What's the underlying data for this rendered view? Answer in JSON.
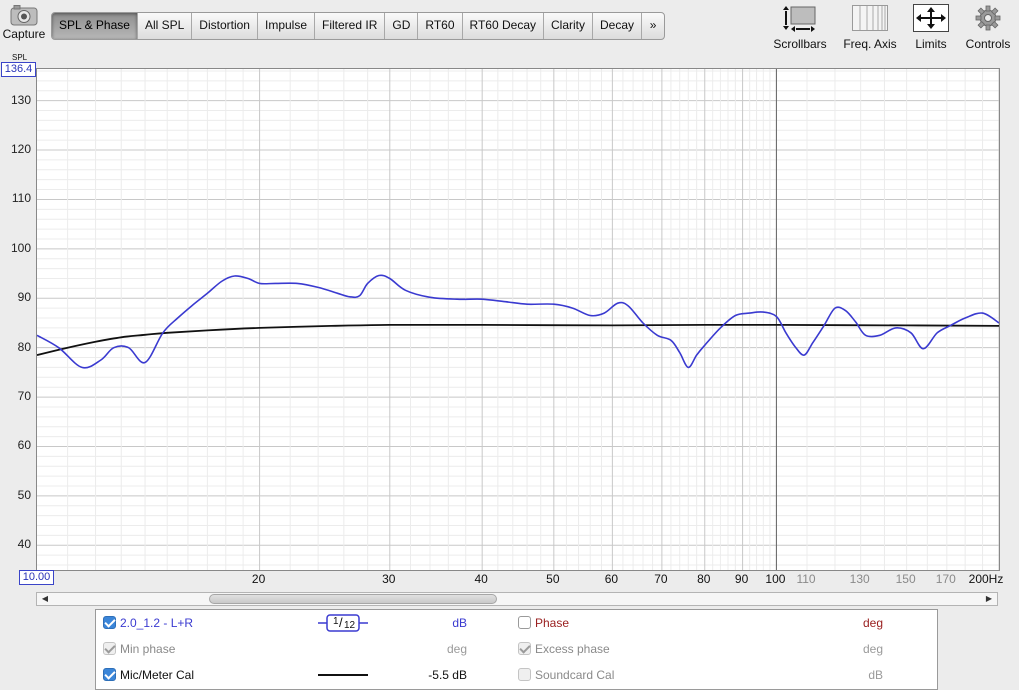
{
  "capture": {
    "label": "Capture",
    "icon": "camera-icon"
  },
  "tabs": [
    {
      "label": "SPL & Phase",
      "active": true
    },
    {
      "label": "All SPL"
    },
    {
      "label": "Distortion"
    },
    {
      "label": "Impulse"
    },
    {
      "label": "Filtered IR"
    },
    {
      "label": "GD"
    },
    {
      "label": "RT60"
    },
    {
      "label": "RT60 Decay"
    },
    {
      "label": "Clarity"
    },
    {
      "label": "Decay"
    },
    {
      "label": "»"
    }
  ],
  "toolbar": {
    "scrollbars": "Scrollbars",
    "freq_axis": "Freq. Axis",
    "limits": "Limits",
    "controls": "Controls"
  },
  "axis": {
    "y_name": "SPL",
    "y_max_field": "136.4",
    "y_ticks": [
      "130",
      "120",
      "110",
      "100",
      "90",
      "80",
      "70",
      "60",
      "50",
      "40"
    ],
    "x_min_field": "10.00",
    "x_ticks": [
      {
        "label": "20",
        "major": true
      },
      {
        "label": "30",
        "major": true
      },
      {
        "label": "40",
        "major": true
      },
      {
        "label": "50",
        "major": true
      },
      {
        "label": "60",
        "major": true
      },
      {
        "label": "70",
        "major": true
      },
      {
        "label": "80",
        "major": true
      },
      {
        "label": "90",
        "major": true
      },
      {
        "label": "100",
        "major": true
      },
      {
        "label": "110",
        "major": false
      },
      {
        "label": "130",
        "major": false
      },
      {
        "label": "150",
        "major": false
      },
      {
        "label": "170",
        "major": false
      },
      {
        "label": "200Hz",
        "major": true
      }
    ]
  },
  "chart_data": {
    "type": "line",
    "xscale": "log",
    "xlim": [
      10,
      200
    ],
    "ylim": [
      35,
      136.4
    ],
    "cursor_x": 100,
    "series": [
      {
        "name": "2.0_1.2 - L+R",
        "color": "#3a3ad0",
        "x": [
          10,
          10.7,
          11.5,
          12.2,
          12.7,
          13.3,
          14,
          14.8,
          15.5,
          16.2,
          17,
          17.8,
          18.5,
          19.3,
          20,
          21,
          22.5,
          24,
          25.5,
          26.5,
          27.3,
          28,
          29,
          30,
          31.5,
          34,
          37,
          40,
          43,
          46,
          50,
          53,
          56,
          58.5,
          61,
          63,
          66,
          69,
          72,
          74,
          76,
          78,
          80,
          84,
          88,
          92,
          96,
          100,
          103,
          106,
          109,
          112,
          116,
          120,
          124,
          128,
          132,
          138,
          145,
          152,
          158,
          165,
          172,
          180,
          190,
          200
        ],
        "values": [
          82.5,
          80,
          76,
          77.5,
          80,
          80,
          77,
          83,
          86,
          88.5,
          91,
          93.5,
          94.5,
          94,
          93,
          93,
          93,
          92.2,
          91,
          90.3,
          90.5,
          93,
          94.6,
          94,
          91.6,
          90.2,
          89.8,
          89.8,
          89.3,
          88.8,
          88.8,
          88,
          86.5,
          87,
          89,
          88.5,
          85,
          82.5,
          81.5,
          79,
          76,
          78.5,
          80.5,
          84,
          86.5,
          87,
          87.2,
          86.3,
          83,
          80.2,
          78.5,
          81,
          84.5,
          88,
          87.5,
          85.2,
          82.5,
          82.5,
          84,
          83,
          79.8,
          83,
          84.5,
          86,
          87,
          85
        ]
      },
      {
        "name": "Mic/Meter Cal",
        "color": "#111111",
        "x": [
          10,
          11,
          12,
          13,
          14,
          15,
          17,
          20,
          25,
          30,
          40,
          60,
          80,
          100,
          150,
          200
        ],
        "values": [
          78.5,
          80,
          81.2,
          82.1,
          82.6,
          83,
          83.5,
          84,
          84.4,
          84.6,
          84.6,
          84.5,
          84.6,
          84.6,
          84.5,
          84.4
        ]
      }
    ]
  },
  "legend": [
    {
      "label": "2.0_1.2 - L+R",
      "checked": true,
      "enabled": true,
      "color": "#3a3ad0",
      "smoothing_num": "1",
      "smoothing_den": "12",
      "value": "dB",
      "right_label": "Phase",
      "right_checked": false,
      "right_enabled": true,
      "right_color": "#9a2020",
      "right_unit": "deg"
    },
    {
      "label": "Min phase",
      "checked": true,
      "enabled": false,
      "value": "deg",
      "right_label": "Excess phase",
      "right_checked": true,
      "right_enabled": false,
      "right_unit": "deg"
    },
    {
      "label": "Mic/Meter Cal",
      "checked": true,
      "enabled": true,
      "value": "-5.5 dB",
      "right_label": "Soundcard Cal",
      "right_checked": false,
      "right_enabled": false,
      "right_unit": "dB"
    }
  ]
}
